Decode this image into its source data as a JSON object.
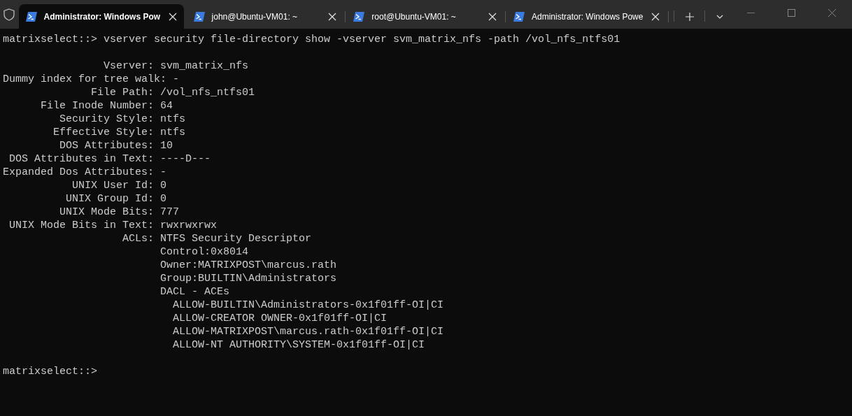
{
  "tabs": [
    {
      "title": "Administrator: Windows Pow",
      "selected": true
    },
    {
      "title": "john@Ubuntu-VM01: ~",
      "selected": false
    },
    {
      "title": "root@Ubuntu-VM01: ~",
      "selected": false
    },
    {
      "title": "Administrator: Windows Powe",
      "selected": false
    }
  ],
  "terminal": {
    "blocks": [
      [
        "matrixselect::> vserver security file-directory show -vserver svm_matrix_nfs -path /vol_nfs_ntfs01"
      ],
      [
        "                Vserver: svm_matrix_nfs",
        "Dummy index for tree walk: -",
        "              File Path: /vol_nfs_ntfs01",
        "      File Inode Number: 64",
        "         Security Style: ntfs",
        "        Effective Style: ntfs",
        "         DOS Attributes: 10",
        " DOS Attributes in Text: ----D---",
        "Expanded Dos Attributes: -",
        "           UNIX User Id: 0",
        "          UNIX Group Id: 0",
        "         UNIX Mode Bits: 777",
        " UNIX Mode Bits in Text: rwxrwxrwx",
        "                   ACLs: NTFS Security Descriptor",
        "                         Control:0x8014",
        "                         Owner:MATRIXPOST\\marcus.rath",
        "                         Group:BUILTIN\\Administrators",
        "                         DACL - ACEs",
        "                           ALLOW-BUILTIN\\Administrators-0x1f01ff-OI|CI",
        "                           ALLOW-CREATOR OWNER-0x1f01ff-OI|CI",
        "                           ALLOW-MATRIXPOST\\marcus.rath-0x1f01ff-OI|CI",
        "                           ALLOW-NT AUTHORITY\\SYSTEM-0x1f01ff-OI|CI"
      ],
      [
        "matrixselect::>"
      ]
    ]
  }
}
